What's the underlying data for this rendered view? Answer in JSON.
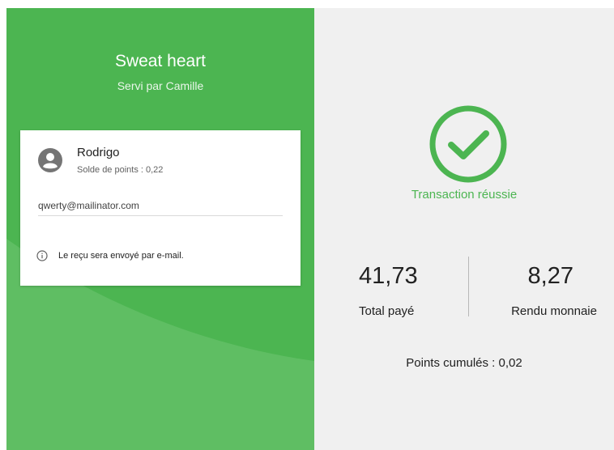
{
  "shop": {
    "name": "Sweat heart",
    "served_by": "Servi par Camille"
  },
  "customer": {
    "name": "Rodrigo",
    "points_balance": "Solde de points : 0,22",
    "email": "qwerty@mailinator.com",
    "receipt_note": "Le reçu sera envoyé par e-mail."
  },
  "transaction": {
    "status": "Transaction réussie",
    "total_value": "41,73",
    "total_label": "Total payé",
    "change_value": "8,27",
    "change_label": "Rendu monnaie",
    "points_earned": "Points cumulés : 0,02"
  },
  "icons": {
    "avatar": "account-circle-icon",
    "info": "info-outline-icon",
    "success": "check-circle-icon"
  },
  "colors": {
    "brand_green": "#4cb551",
    "right_background": "#f0f0f0",
    "text_dark": "#212121"
  }
}
